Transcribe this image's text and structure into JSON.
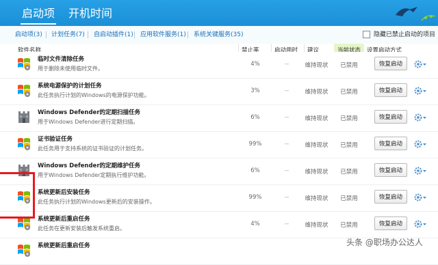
{
  "header": {
    "tabs": [
      {
        "label": "启动项",
        "active": true
      },
      {
        "label": "开机时间",
        "active": false
      }
    ]
  },
  "subtabs": [
    "启动项(3)",
    "计划任务(7)",
    "自启动插件(1)",
    "应用软件服务(1)",
    "系统关键服务(35)"
  ],
  "hide_disabled_label": "隐藏已禁止启动的项目",
  "columns": {
    "name": "软件名称",
    "rate": "禁止率",
    "time": "启动用时",
    "suggestion": "建议",
    "status": "当前状态",
    "action": "设置启动方式"
  },
  "rows": [
    {
      "name": "临时文件清除任务",
      "desc": "用于删除未使用临时文件。",
      "rate": "4%",
      "time": "--",
      "suggestion": "维持现状",
      "status": "已禁用",
      "button": "恢复启动",
      "icon": "windows-logo-icon"
    },
    {
      "name": "系统电源保护的计划任务",
      "desc": "此任务执行计划的Windows的电源保护功能。",
      "rate": "3%",
      "time": "--",
      "suggestion": "维持现状",
      "status": "已禁用",
      "button": "恢复启动",
      "icon": "windows-logo-icon"
    },
    {
      "name": "Windows Defender的定期扫描任务",
      "desc": "用于Windows Defender进行定期扫描。",
      "rate": "6%",
      "time": "--",
      "suggestion": "维持现状",
      "status": "已禁用",
      "button": "恢复启动",
      "icon": "castle-icon"
    },
    {
      "name": "证书验证任务",
      "desc": "此任务用于支持系统的证书验证的计划任务。",
      "rate": "99%",
      "time": "--",
      "suggestion": "维持现状",
      "status": "已禁用",
      "button": "恢复启动",
      "icon": "windows-logo-icon"
    },
    {
      "name": "Windows Defender的定期维护任务",
      "desc": "用于Windows Defender定期执行维护功能。",
      "rate": "6%",
      "time": "--",
      "suggestion": "维持现状",
      "status": "已禁用",
      "button": "恢复启动",
      "icon": "castle-icon"
    },
    {
      "name": "系统更新后安装任务",
      "desc": "此任务执行计划的Windows更新后的安装操作。",
      "rate": "99%",
      "time": "--",
      "suggestion": "维持现状",
      "status": "已禁用",
      "button": "恢复启动",
      "icon": "windows-logo-icon"
    },
    {
      "name": "系统更新后重启任务",
      "desc": "此任务在更新安装后触发系统重启。",
      "rate": "4%",
      "time": "--",
      "suggestion": "维持现状",
      "status": "已禁用",
      "button": "恢复启动",
      "icon": "windows-logo-icon"
    },
    {
      "name": "系统更新后重启任务",
      "desc": "",
      "rate": "",
      "time": "",
      "suggestion": "",
      "status": "",
      "button": "",
      "icon": "windows-logo-icon"
    }
  ],
  "watermark": "头条 @职场办公达人"
}
